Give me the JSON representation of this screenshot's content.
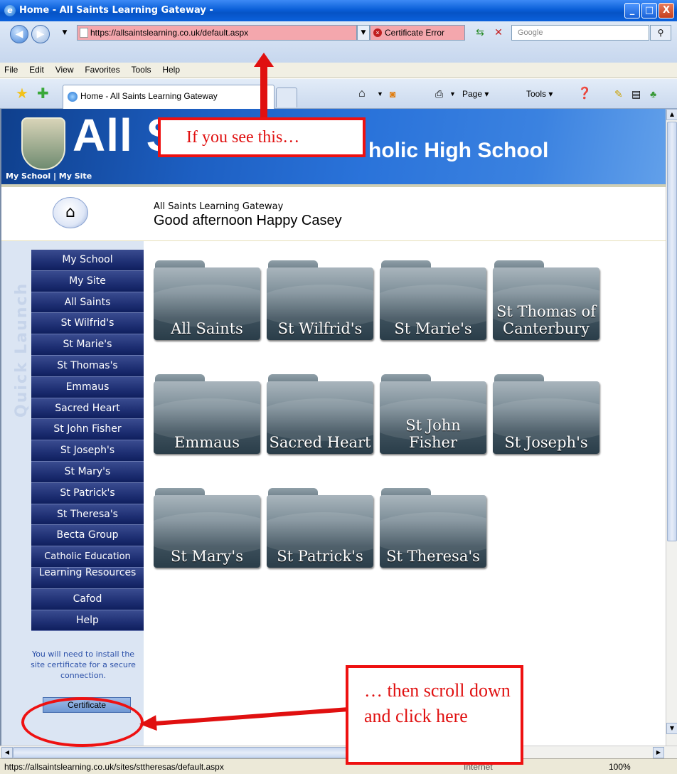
{
  "window": {
    "title": "Home - All Saints Learning Gateway -",
    "min_glyph": "_",
    "max_glyph": "□",
    "close_glyph": "X"
  },
  "addressbar": {
    "back_glyph": "◀",
    "forward_glyph": "▶",
    "url": "https://allsaintslearning.co.uk/default.aspx",
    "cert_error": "Certificate Error",
    "search_placeholder": "Google"
  },
  "menu": [
    "File",
    "Edit",
    "View",
    "Favorites",
    "Tools",
    "Help"
  ],
  "tabbar": {
    "tab_title": "Home - All Saints Learning Gateway",
    "page_label": "Page ▾",
    "tools_label": "Tools ▾"
  },
  "banner": {
    "brand_left": "All S",
    "brand_right": "holic High School",
    "link_my_school": "My School",
    "link_sep": " | ",
    "link_my_site": "My Site"
  },
  "header": {
    "gateway_name": "All Saints Learning Gateway",
    "greeting": "Good afternoon Happy Casey"
  },
  "sidebar": {
    "quick_launch": "Quick Launch",
    "items": [
      "My School",
      "My Site",
      "All Saints",
      "St Wilfrid's",
      "St Marie's",
      "St Thomas's",
      "Emmaus",
      "Sacred Heart",
      "St John Fisher",
      "St Joseph's",
      "St Mary's",
      "St Patrick's",
      "St Theresa's",
      "Becta Group",
      "Catholic Education",
      "Learning Resources",
      "Cafod",
      "Help"
    ],
    "cert_note": "You will need to install the site certificate for a secure connection.",
    "cert_button": "Certificate"
  },
  "folders": [
    "All Saints",
    "St Wilfrid's",
    "St Marie's",
    "St Thomas of Canterbury",
    "Emmaus",
    "Sacred Heart",
    "St John Fisher",
    "St Joseph's",
    "St Mary's",
    "St Patrick's",
    "St Theresa's"
  ],
  "annotations": {
    "top": "If you see this…",
    "bottom": "… then scroll down and click here"
  },
  "status": {
    "url": "https://allsaintslearning.co.uk/sites/sttheresas/default.aspx",
    "zone": "Internet",
    "zoom": "100%"
  },
  "colors": {
    "accent": "#1e2f73",
    "error_bg": "#f4a7ad",
    "annotation": "#e01010"
  }
}
